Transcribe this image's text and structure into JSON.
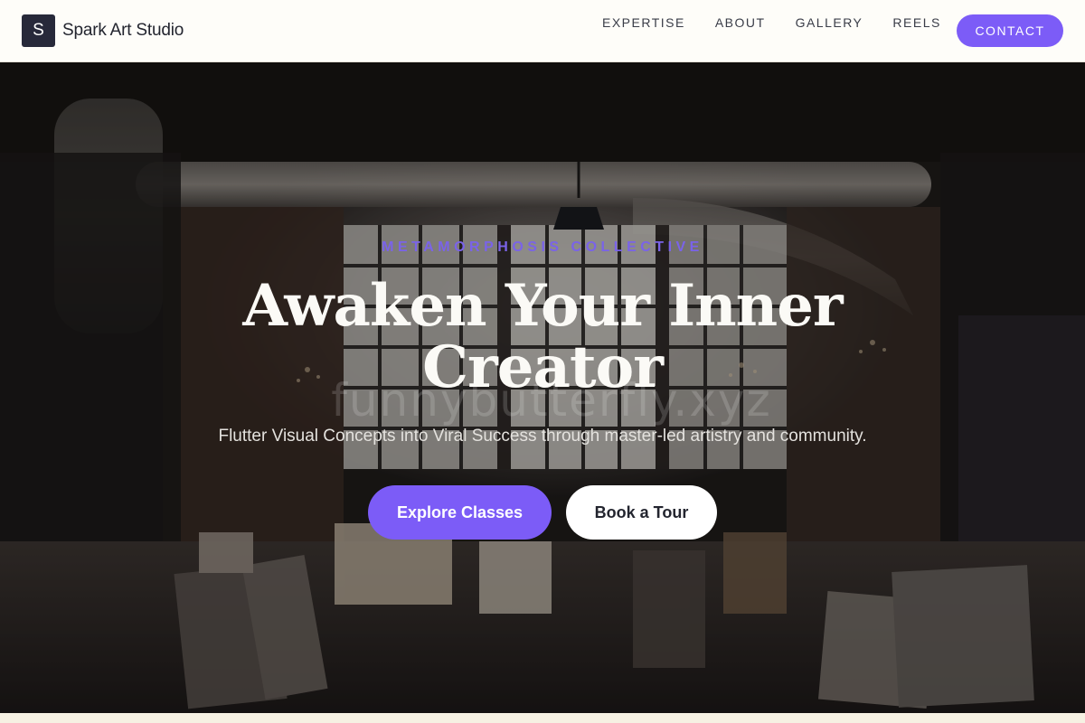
{
  "header": {
    "logo_letter": "S",
    "brand_name": "Spark Art Studio",
    "nav": [
      {
        "label": "EXPERTISE"
      },
      {
        "label": "ABOUT"
      },
      {
        "label": "GALLERY"
      },
      {
        "label": "REELS"
      }
    ],
    "contact_label": "CONTACT"
  },
  "hero": {
    "eyebrow": "METAMORPHOSIS COLLECTIVE",
    "headline": "Awaken Your Inner Creator",
    "watermark": "funnybutterfly.xyz",
    "subtitle": "Flutter Visual Concepts into Viral Success through master-led artistry and community.",
    "primary_cta": "Explore Classes",
    "secondary_cta": "Book a Tour"
  },
  "colors": {
    "accent": "#7c5cf7",
    "eyebrow": "#7a63e8",
    "header_bg": "#fefdf9",
    "logo_bg": "#27293a"
  }
}
